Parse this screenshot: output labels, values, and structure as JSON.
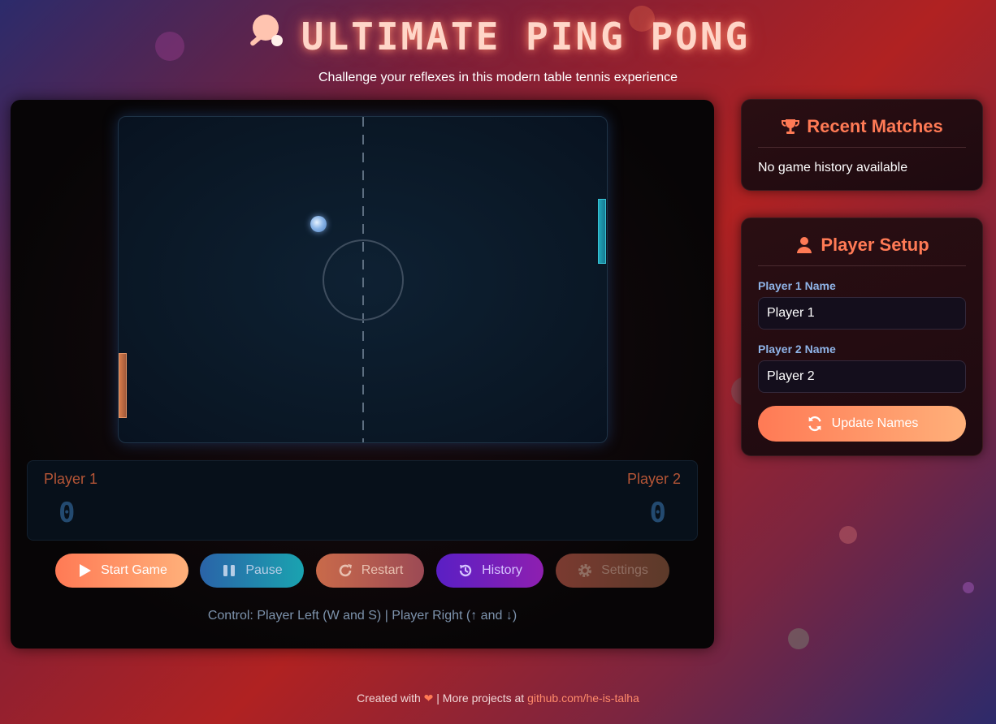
{
  "header": {
    "title": "ULTIMATE PING PONG",
    "subtitle": "Challenge your reflexes in this modern table tennis experience",
    "logo_icon": "ping-pong-icon"
  },
  "game": {
    "left_player": "Player 1",
    "right_player": "Player 2",
    "left_score": "0",
    "right_score": "0",
    "control_hint": "Control: Player Left (W and S) | Player Right (↑ and ↓)"
  },
  "controls": {
    "start_label": "Start Game",
    "pause_label": "Pause",
    "restart_label": "Restart",
    "history_label": "History",
    "settings_label": "Settings"
  },
  "recent_matches": {
    "title": "Recent Matches",
    "empty_text": "No game history available"
  },
  "player_setup": {
    "title": "Player Setup",
    "player1_label": "Player 1 Name",
    "player1_value": "Player 1",
    "player2_label": "Player 2 Name",
    "player2_value": "Player 2",
    "update_label": "Update Names"
  },
  "footer": {
    "created_prefix": "Created with",
    "more_text": "| More projects at",
    "link_text": "github.com/he-is-talha"
  },
  "colors": {
    "accent": "#ff7a55",
    "left_paddle": "#d67a4a",
    "right_paddle": "#1fa4b8",
    "label_blue": "#8fb4e8"
  }
}
